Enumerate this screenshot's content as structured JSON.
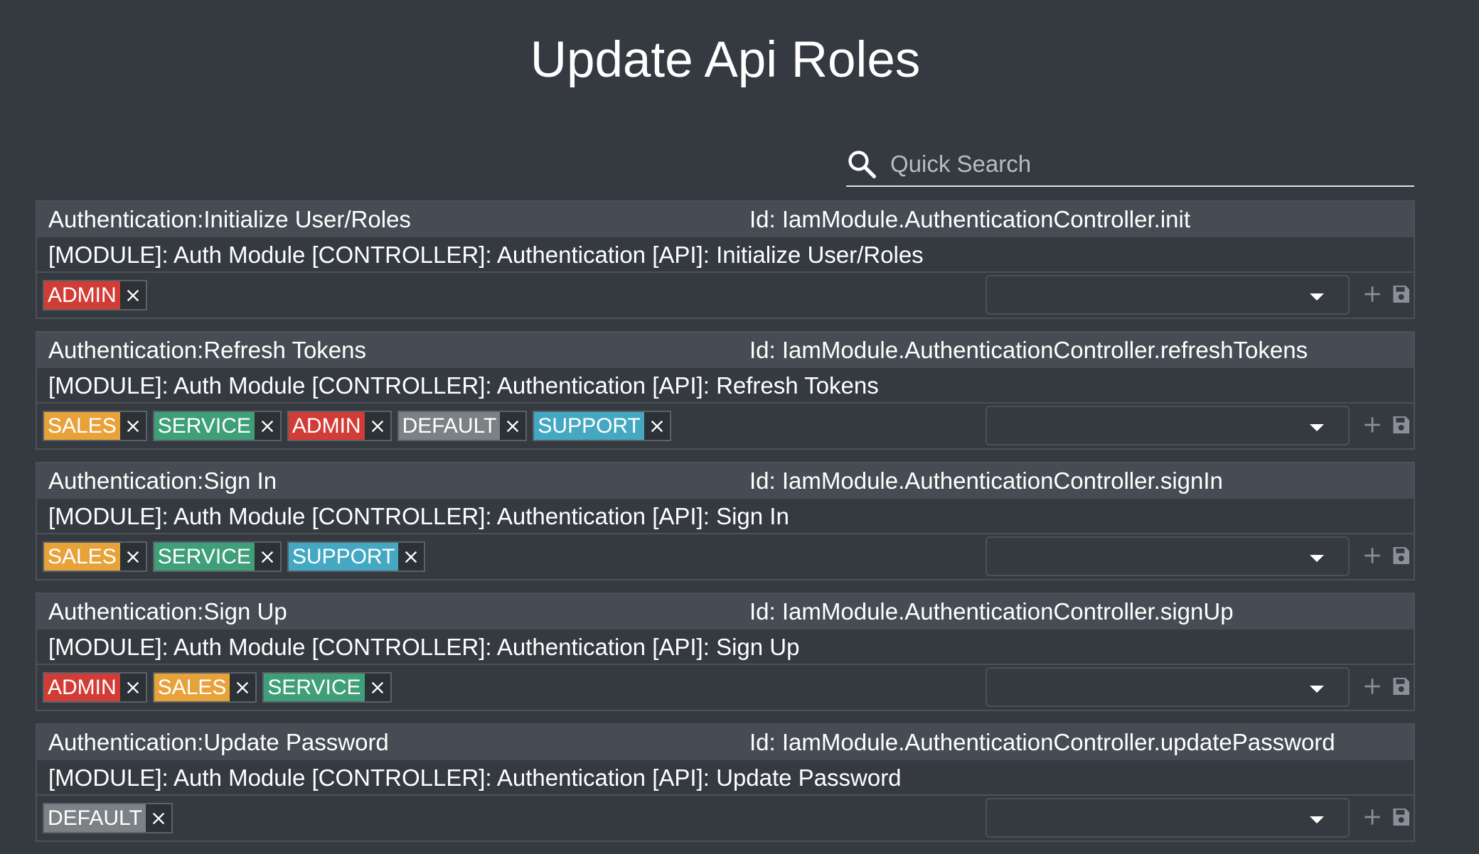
{
  "page": {
    "title": "Update Api Roles"
  },
  "search": {
    "placeholder": "Quick Search",
    "value": ""
  },
  "colors": {
    "background": "#343a40",
    "header": "#454c53",
    "SALES": "#e8a23a",
    "SERVICE": "#3f9f78",
    "ADMIN": "#d23c36",
    "DEFAULT": "#7c8186",
    "SUPPORT": "#45a8c2"
  },
  "apis": [
    {
      "name": "Authentication:Initialize User/Roles",
      "id": "Id: IamModule.AuthenticationController.init",
      "description": "[MODULE]: Auth Module [CONTROLLER]: Authentication [API]: Initialize User/Roles",
      "roles": [
        "ADMIN"
      ],
      "selected_role": ""
    },
    {
      "name": "Authentication:Refresh Tokens",
      "id": "Id: IamModule.AuthenticationController.refreshTokens",
      "description": "[MODULE]: Auth Module [CONTROLLER]: Authentication [API]: Refresh Tokens",
      "roles": [
        "SALES",
        "SERVICE",
        "ADMIN",
        "DEFAULT",
        "SUPPORT"
      ],
      "selected_role": ""
    },
    {
      "name": "Authentication:Sign In",
      "id": "Id: IamModule.AuthenticationController.signIn",
      "description": "[MODULE]: Auth Module [CONTROLLER]: Authentication [API]: Sign In",
      "roles": [
        "SALES",
        "SERVICE",
        "SUPPORT"
      ],
      "selected_role": ""
    },
    {
      "name": "Authentication:Sign Up",
      "id": "Id: IamModule.AuthenticationController.signUp",
      "description": "[MODULE]: Auth Module [CONTROLLER]: Authentication [API]: Sign Up",
      "roles": [
        "ADMIN",
        "SALES",
        "SERVICE"
      ],
      "selected_role": ""
    },
    {
      "name": "Authentication:Update Password",
      "id": "Id: IamModule.AuthenticationController.updatePassword",
      "description": "[MODULE]: Auth Module [CONTROLLER]: Authentication [API]: Update Password",
      "roles": [
        "DEFAULT"
      ],
      "selected_role": ""
    }
  ],
  "icons": {
    "search": "search-icon",
    "chip_remove": "close-icon",
    "dropdown": "chevron-down-icon",
    "add": "plus-icon",
    "save": "save-icon"
  }
}
